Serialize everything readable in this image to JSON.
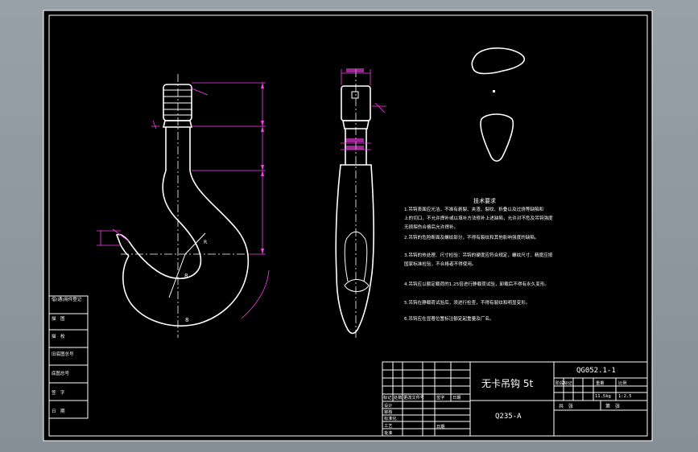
{
  "drawing": {
    "title": "无卡吊钩 5t",
    "drawing_number": "QG052.1-1",
    "material": "Q235-A",
    "notes_heading": "技术要求",
    "notes": [
      "1.吊钩表面应光洁，不准有剥裂、夹渣、裂纹、折叠以及过烧等缺陷和",
      "上的切口，不允许焊补或以填补方法修补上述缺陷，允许对不危及吊钩强度",
      "无损探伤合格后允许焊补。",
      "2.吊钩的危险断面及螺纹部分，不得有裂纹和其他影响强度的缺陷。",
      "3.吊钩的热处理、尺寸检验：吊钩的硬度应符合规定，螺纹尺寸、精度应按",
      "国家标准检验，不合格者不得使用。",
      "4.吊钩应以额定载荷的1.25倍进行静载荷试验，卸载后不得有永久变形。",
      "5.吊钩在静载荷试验后，须进行检查，不得有裂纹和明显变形。",
      "6.吊钩应在显著位置标注额定起重量及厂名。"
    ],
    "scale_left": "11.5kg",
    "scale_right": "1:2.5",
    "dim_labels": {
      "radius_a": "R",
      "radius_b": "8",
      "radius_c": "8"
    }
  },
  "left_table": {
    "rows": [
      "借(通)用件登记",
      "描　图",
      "描　校",
      "旧底图总号",
      "底图总号",
      "签　字",
      "日　期"
    ]
  },
  "title_block": {
    "revision_headers": [
      "标记",
      "处数",
      "更改文件号",
      "签字",
      "日期"
    ],
    "signoff_rows": [
      "设计",
      "审核",
      "标准化",
      "工艺",
      "批准"
    ],
    "signoff_date": "日期",
    "stage_headers": [
      "阶段标记",
      "重量",
      "比例"
    ],
    "sheet_total": "共　张",
    "sheet_no": "第　张"
  },
  "colors": {
    "background": "#000000",
    "lines": "#ffffff",
    "dimensions": "#ff3df0",
    "viewport": "#8e969e"
  }
}
